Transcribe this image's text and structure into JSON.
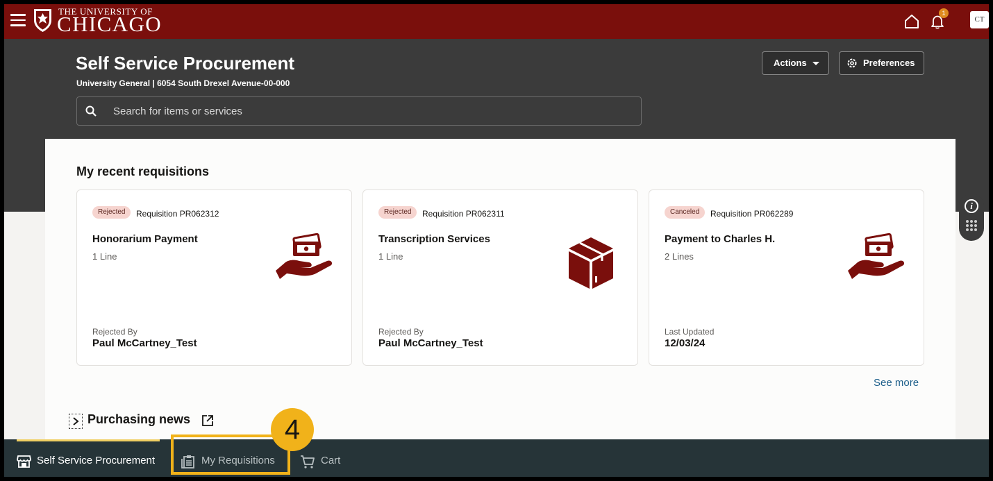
{
  "header": {
    "logo_small": "THE UNIVERSITY OF",
    "logo_big": "CHICAGO",
    "notification_count": "1",
    "user_initials": "CT",
    "brand_color": "#7a0f0c"
  },
  "hero": {
    "title": "Self Service Procurement",
    "subtitle": "University General | 6054 South Drexel Avenue-00-000",
    "actions_label": "Actions",
    "preferences_label": "Preferences",
    "search_placeholder": "Search for items or services"
  },
  "recent": {
    "heading": "My recent requisitions",
    "see_more": "See more",
    "cards": [
      {
        "status": "Rejected",
        "requisition": "Requisition PR062312",
        "title": "Honorarium Payment",
        "lines": "1 Line",
        "icon": "hand-money-icon",
        "meta_label": "Rejected By",
        "meta_value": "Paul McCartney_Test"
      },
      {
        "status": "Rejected",
        "requisition": "Requisition PR062311",
        "title": "Transcription Services",
        "lines": "1 Line",
        "icon": "package-box-icon",
        "meta_label": "Rejected By",
        "meta_value": "Paul McCartney_Test"
      },
      {
        "status": "Canceled",
        "requisition": "Requisition PR062289",
        "title": "Payment to Charles H.",
        "lines": "2 Lines",
        "icon": "hand-money-icon",
        "meta_label": "Last Updated",
        "meta_value": "12/03/24"
      }
    ]
  },
  "news": {
    "title": "Purchasing news"
  },
  "bottom_nav": {
    "items": [
      {
        "label": "Self Service Procurement",
        "icon": "store-icon",
        "active": true
      },
      {
        "label": "My Requisitions",
        "icon": "clipboard-list-icon",
        "active": false
      },
      {
        "label": "Cart",
        "icon": "cart-icon",
        "active": false
      }
    ]
  },
  "callout": {
    "step": "4",
    "color": "#f1b21a"
  }
}
